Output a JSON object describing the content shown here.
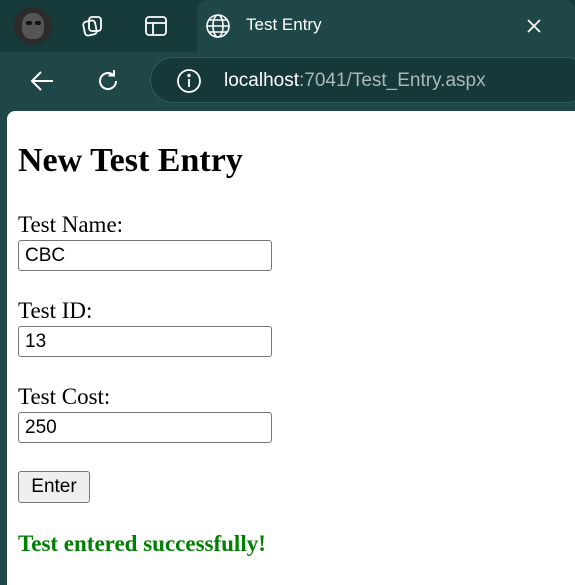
{
  "browser": {
    "tab_title": "Test Entry",
    "url_host": "localhost",
    "url_path": ":7041/Test_Entry.aspx",
    "colors": {
      "frame": "#173a3a",
      "toolbar": "#1f4747"
    }
  },
  "icons": {
    "profile": "profile-avatar",
    "workspaces": "workspaces-icon",
    "tab_actions": "tab-actions-icon",
    "tab_favicon": "globe-icon",
    "close": "close-icon",
    "back": "back-arrow-icon",
    "refresh": "refresh-icon",
    "site_info": "info-icon"
  },
  "form": {
    "heading": "New Test Entry",
    "test_name_label": "Test Name:",
    "test_name_value": "CBC",
    "test_id_label": "Test ID:",
    "test_id_value": "13",
    "test_cost_label": "Test Cost:",
    "test_cost_value": "250",
    "enter_label": "Enter",
    "status_message": "Test entered successfully!",
    "status_color": "#008000"
  }
}
